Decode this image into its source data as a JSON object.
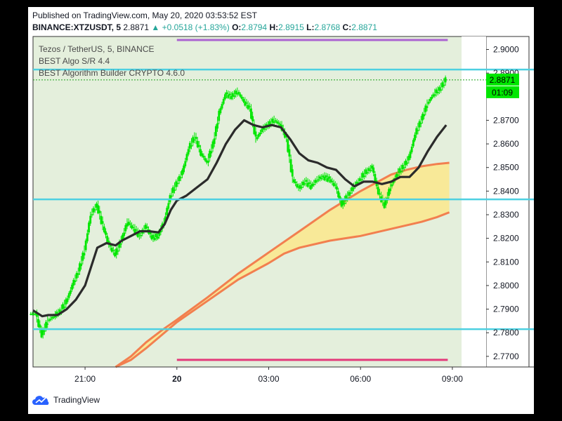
{
  "header": {
    "published": "Published on TradingView.com, May 20, 2020 03:53:52 EST",
    "symbol": "BINANCE:XTZUSDT, 5",
    "last": "2.8871",
    "change": "+0.0518 (+1.83%)",
    "open_label": "O:",
    "open": "2.8794",
    "high_label": "H:",
    "high": "2.8915",
    "low_label": "L:",
    "low": "2.8768",
    "close_label": "C:",
    "close": "2.8871"
  },
  "legend": [
    "Tezos / TetherUS, 5, BINANCE",
    "BEST Algo S/R 4.4",
    "BEST Algorithm Builder CRYPTO 4.6.0"
  ],
  "price_tag": "2.8871",
  "countdown": "01:09",
  "footer_brand": "TradingView",
  "colors": {
    "bg": "#e4efdc",
    "up": "#00e600",
    "sr": "#4dd0e1",
    "purple": "#ab63d1",
    "magenta": "#e33a7a",
    "ma": "#2b2b2b",
    "band": "#fbe78c",
    "band_edge": "#f27f4f"
  },
  "chart_data": {
    "type": "candlestick",
    "yticks": [
      "2.9000",
      "2.8900",
      "2.8700",
      "2.8600",
      "2.8500",
      "2.8400",
      "2.8300",
      "2.8200",
      "2.8100",
      "2.8000",
      "2.7900",
      "2.7800",
      "2.7700"
    ],
    "ylim": [
      2.7655,
      2.9055
    ],
    "xticks": [
      "21:00",
      "20",
      "03:00",
      "06:00",
      "09:00"
    ],
    "x_time_hours": [
      -3,
      0,
      3,
      6,
      9
    ],
    "xlim_hours": [
      -4.7,
      9.3
    ],
    "support_resistance": [
      2.8915,
      2.8365,
      2.7815
    ],
    "purple_level": 2.904,
    "magenta_level": 2.7685,
    "last_price": 2.8871,
    "close_points": [
      [
        -4.6,
        2.788
      ],
      [
        -4.4,
        2.779
      ],
      [
        -4.2,
        2.785
      ],
      [
        -4.0,
        2.787
      ],
      [
        -3.8,
        2.789
      ],
      [
        -3.6,
        2.793
      ],
      [
        -3.4,
        2.8
      ],
      [
        -3.2,
        2.806
      ],
      [
        -3.0,
        2.815
      ],
      [
        -2.8,
        2.83
      ],
      [
        -2.6,
        2.834
      ],
      [
        -2.4,
        2.825
      ],
      [
        -2.2,
        2.817
      ],
      [
        -2.0,
        2.813
      ],
      [
        -1.8,
        2.819
      ],
      [
        -1.6,
        2.827
      ],
      [
        -1.4,
        2.824
      ],
      [
        -1.2,
        2.821
      ],
      [
        -1.0,
        2.825
      ],
      [
        -0.8,
        2.82
      ],
      [
        -0.6,
        2.821
      ],
      [
        -0.4,
        2.827
      ],
      [
        -0.2,
        2.838
      ],
      [
        0.0,
        2.843
      ],
      [
        0.2,
        2.848
      ],
      [
        0.4,
        2.858
      ],
      [
        0.6,
        2.863
      ],
      [
        0.8,
        2.856
      ],
      [
        1.0,
        2.852
      ],
      [
        1.2,
        2.86
      ],
      [
        1.4,
        2.873
      ],
      [
        1.6,
        2.881
      ],
      [
        1.8,
        2.88
      ],
      [
        2.0,
        2.882
      ],
      [
        2.2,
        2.878
      ],
      [
        2.4,
        2.875
      ],
      [
        2.6,
        2.862
      ],
      [
        2.8,
        2.866
      ],
      [
        3.0,
        2.868
      ],
      [
        3.2,
        2.87
      ],
      [
        3.4,
        2.868
      ],
      [
        3.6,
        2.862
      ],
      [
        3.8,
        2.845
      ],
      [
        4.0,
        2.841
      ],
      [
        4.2,
        2.844
      ],
      [
        4.4,
        2.842
      ],
      [
        4.6,
        2.845
      ],
      [
        4.8,
        2.846
      ],
      [
        5.0,
        2.845
      ],
      [
        5.2,
        2.842
      ],
      [
        5.4,
        2.834
      ],
      [
        5.6,
        2.838
      ],
      [
        5.8,
        2.842
      ],
      [
        6.0,
        2.845
      ],
      [
        6.2,
        2.848
      ],
      [
        6.4,
        2.85
      ],
      [
        6.6,
        2.839
      ],
      [
        6.8,
        2.834
      ],
      [
        7.0,
        2.842
      ],
      [
        7.2,
        2.847
      ],
      [
        7.4,
        2.85
      ],
      [
        7.6,
        2.854
      ],
      [
        7.8,
        2.864
      ],
      [
        8.0,
        2.87
      ],
      [
        8.2,
        2.877
      ],
      [
        8.4,
        2.881
      ],
      [
        8.6,
        2.883
      ],
      [
        8.8,
        2.8871
      ]
    ],
    "moving_average": [
      [
        -4.7,
        2.7895
      ],
      [
        -4.4,
        2.787
      ],
      [
        -4.2,
        2.7875
      ],
      [
        -3.9,
        2.7875
      ],
      [
        -3.6,
        2.79
      ],
      [
        -3.3,
        2.794
      ],
      [
        -3.0,
        2.8
      ],
      [
        -2.8,
        2.808
      ],
      [
        -2.6,
        2.816
      ],
      [
        -2.3,
        2.818
      ],
      [
        -2.0,
        2.817
      ],
      [
        -1.8,
        2.819
      ],
      [
        -1.5,
        2.821
      ],
      [
        -1.2,
        2.823
      ],
      [
        -0.9,
        2.823
      ],
      [
        -0.6,
        2.8225
      ],
      [
        -0.4,
        2.826
      ],
      [
        -0.2,
        2.832
      ],
      [
        0.0,
        2.836
      ],
      [
        0.3,
        2.838
      ],
      [
        0.6,
        2.841
      ],
      [
        1.0,
        2.845
      ],
      [
        1.3,
        2.852
      ],
      [
        1.6,
        2.86
      ],
      [
        1.9,
        2.866
      ],
      [
        2.2,
        2.87
      ],
      [
        2.5,
        2.868
      ],
      [
        2.8,
        2.867
      ],
      [
        3.1,
        2.868
      ],
      [
        3.4,
        2.867
      ],
      [
        3.7,
        2.862
      ],
      [
        4.0,
        2.856
      ],
      [
        4.3,
        2.853
      ],
      [
        4.6,
        2.852
      ],
      [
        4.9,
        2.85
      ],
      [
        5.2,
        2.849
      ],
      [
        5.5,
        2.845
      ],
      [
        5.8,
        2.842
      ],
      [
        6.1,
        2.844
      ],
      [
        6.4,
        2.844
      ],
      [
        6.7,
        2.843
      ],
      [
        7.0,
        2.844
      ],
      [
        7.3,
        2.846
      ],
      [
        7.6,
        2.846
      ],
      [
        7.9,
        2.85
      ],
      [
        8.2,
        2.857
      ],
      [
        8.5,
        2.863
      ],
      [
        8.8,
        2.868
      ]
    ],
    "band_upper": [
      [
        -2.0,
        2.7645
      ],
      [
        -1.5,
        2.77
      ],
      [
        -1.0,
        2.776
      ],
      [
        -0.5,
        2.781
      ],
      [
        0.0,
        2.7855
      ],
      [
        1.0,
        2.795
      ],
      [
        2.0,
        2.805
      ],
      [
        3.0,
        2.814
      ],
      [
        4.0,
        2.823
      ],
      [
        5.0,
        2.832
      ],
      [
        6.0,
        2.84
      ],
      [
        7.0,
        2.847
      ],
      [
        7.5,
        2.849
      ],
      [
        8.0,
        2.8505
      ],
      [
        8.5,
        2.8515
      ],
      [
        8.9,
        2.852
      ]
    ],
    "band_lower": [
      [
        -2.0,
        2.764
      ],
      [
        -1.5,
        2.7685
      ],
      [
        -1.0,
        2.7735
      ],
      [
        -0.5,
        2.779
      ],
      [
        0.0,
        2.7845
      ],
      [
        1.0,
        2.7935
      ],
      [
        2.0,
        2.8025
      ],
      [
        3.0,
        2.8095
      ],
      [
        3.5,
        2.8135
      ],
      [
        4.0,
        2.816
      ],
      [
        5.0,
        2.819
      ],
      [
        6.0,
        2.821
      ],
      [
        7.0,
        2.824
      ],
      [
        8.0,
        2.827
      ],
      [
        8.5,
        2.829
      ],
      [
        8.9,
        2.831
      ]
    ]
  }
}
